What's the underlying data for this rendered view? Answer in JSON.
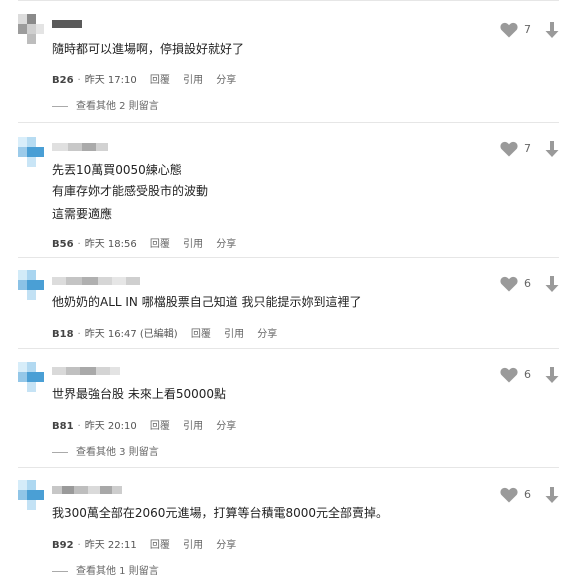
{
  "comments": [
    {
      "lines": [
        "隨時都可以進場啊，停損設好就好了"
      ],
      "floor": "B26",
      "time": "昨天 17:10",
      "reply": "回覆",
      "quote": "引用",
      "share": "分享",
      "likes": "7",
      "more_replies": "查看其他 2 則留言"
    },
    {
      "lines": [
        "先丟10萬買0050練心態",
        "有庫存妳才能感受股市的波動",
        "這需要適應"
      ],
      "floor": "B56",
      "time": "昨天 18:56",
      "reply": "回覆",
      "quote": "引用",
      "share": "分享",
      "likes": "7"
    },
    {
      "lines": [
        "他奶奶的ALL IN 哪檔股票自己知道 我只能提示妳到這裡了"
      ],
      "floor": "B18",
      "time": "昨天 16:47 (已編輯)",
      "reply": "回覆",
      "quote": "引用",
      "share": "分享",
      "likes": "6"
    },
    {
      "lines": [
        "世界最強台股 未來上看50000點"
      ],
      "floor": "B81",
      "time": "昨天 20:10",
      "reply": "回覆",
      "quote": "引用",
      "share": "分享",
      "likes": "6",
      "more_replies": "查看其他 3 則留言"
    },
    {
      "lines": [
        "我300萬全部在2060元進場，打算等台積電8000元全部賣掉。"
      ],
      "floor": "B92",
      "time": "昨天 22:11",
      "reply": "回覆",
      "quote": "引用",
      "share": "分享",
      "likes": "6",
      "more_replies": "查看其他 1 則留言"
    }
  ],
  "colors": {
    "text": "#222222",
    "meta": "#666666",
    "icon": "#999999",
    "divider": "#e6e6e6",
    "avatar_blue": "#4a9fd5"
  },
  "icons": {
    "like": "heart-icon",
    "dislike": "arrow-down-icon"
  }
}
